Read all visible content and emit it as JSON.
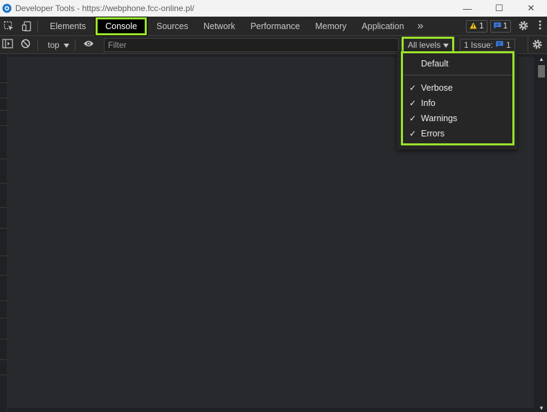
{
  "window": {
    "title": "Developer Tools - https://webphone.fcc-online.pl/",
    "minimize": "—",
    "maximize": "☐",
    "close": "✕"
  },
  "tabs": [
    {
      "label": "Elements",
      "active": false
    },
    {
      "label": "Console",
      "active": true
    },
    {
      "label": "Sources",
      "active": false
    },
    {
      "label": "Network",
      "active": false
    },
    {
      "label": "Performance",
      "active": false
    },
    {
      "label": "Memory",
      "active": false
    },
    {
      "label": "Application",
      "active": false
    }
  ],
  "more_tabs": "»",
  "warnings_count": "1",
  "messages_count": "1",
  "toolbar": {
    "context": "top",
    "filter_placeholder": "Filter",
    "levels_label": "All levels",
    "issues_label": "1 Issue:",
    "issues_count": "1"
  },
  "levels_menu": {
    "default": "Default",
    "items": [
      {
        "label": "Verbose",
        "checked": true
      },
      {
        "label": "Info",
        "checked": true
      },
      {
        "label": "Warnings",
        "checked": true
      },
      {
        "label": "Errors",
        "checked": true
      }
    ]
  },
  "colors": {
    "highlight": "#9be32b",
    "warning": "#f2c21b",
    "info": "#3b82f6"
  }
}
